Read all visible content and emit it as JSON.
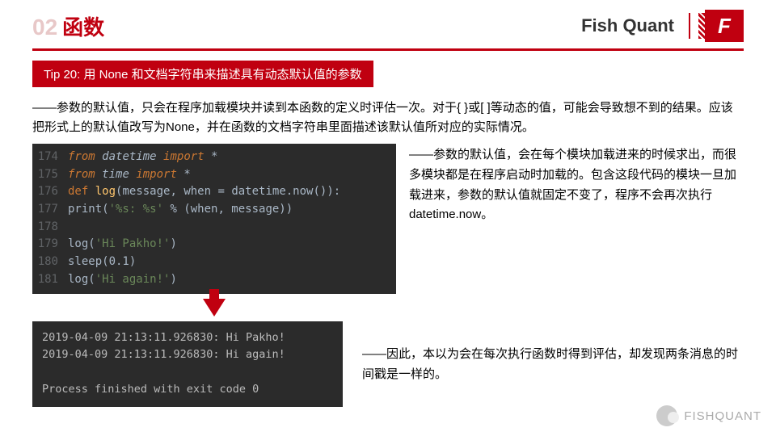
{
  "header": {
    "chapter_num": "02",
    "chapter_title": "函数",
    "brand": "Fish Quant",
    "logo_letter": "F"
  },
  "tip": {
    "label": "Tip 20: 用 None 和文档字符串来描述具有动态默认值的参数"
  },
  "para1": "——参数的默认值，只会在程序加载模块并读到本函数的定义时评估一次。对于{ }或[ ]等动态的值，可能会导致想不到的结果。应该把形式上的默认值改写为None，并在函数的文档字符串里面描述该默认值所对应的实际情况。",
  "code": {
    "lines": [
      {
        "n": "174",
        "html": "<span class='kw cm'>from</span> <span class='cm'>datetime</span> <span class='kw cm'>import</span> *"
      },
      {
        "n": "175",
        "html": "<span class='kw cm'>from</span> <span class='cm'>time</span> <span class='kw cm'>import</span> *"
      },
      {
        "n": "176",
        "html": "<span class='kw'>def</span> <span class='fn'>log</span>(message, when = datetime.now()):"
      },
      {
        "n": "177",
        "html": "    print(<span class='str'>'%s: %s'</span> % (when, message))"
      },
      {
        "n": "178",
        "html": ""
      },
      {
        "n": "179",
        "html": "log(<span class='str'>'Hi Pakho!'</span>)"
      },
      {
        "n": "180",
        "html": "sleep(<span>0.1</span>)"
      },
      {
        "n": "181",
        "html": "log(<span class='str'>'Hi again!'</span>)"
      }
    ]
  },
  "side1": "——参数的默认值，会在每个模块加载进来的时候求出，而很多模块都是在程序启动时加载的。包含这段代码的模块一旦加载进来，参数的默认值就固定不变了，程序不会再次执行datetime.now。",
  "output": "2019-04-09 21:13:11.926830: Hi Pakho!\n2019-04-09 21:13:11.926830: Hi again!\n\nProcess finished with exit code 0",
  "side2": "——因此，本以为会在每次执行函数时得到评估，却发现两条消息的时间戳是一样的。",
  "watermark": "FISHQUANT"
}
